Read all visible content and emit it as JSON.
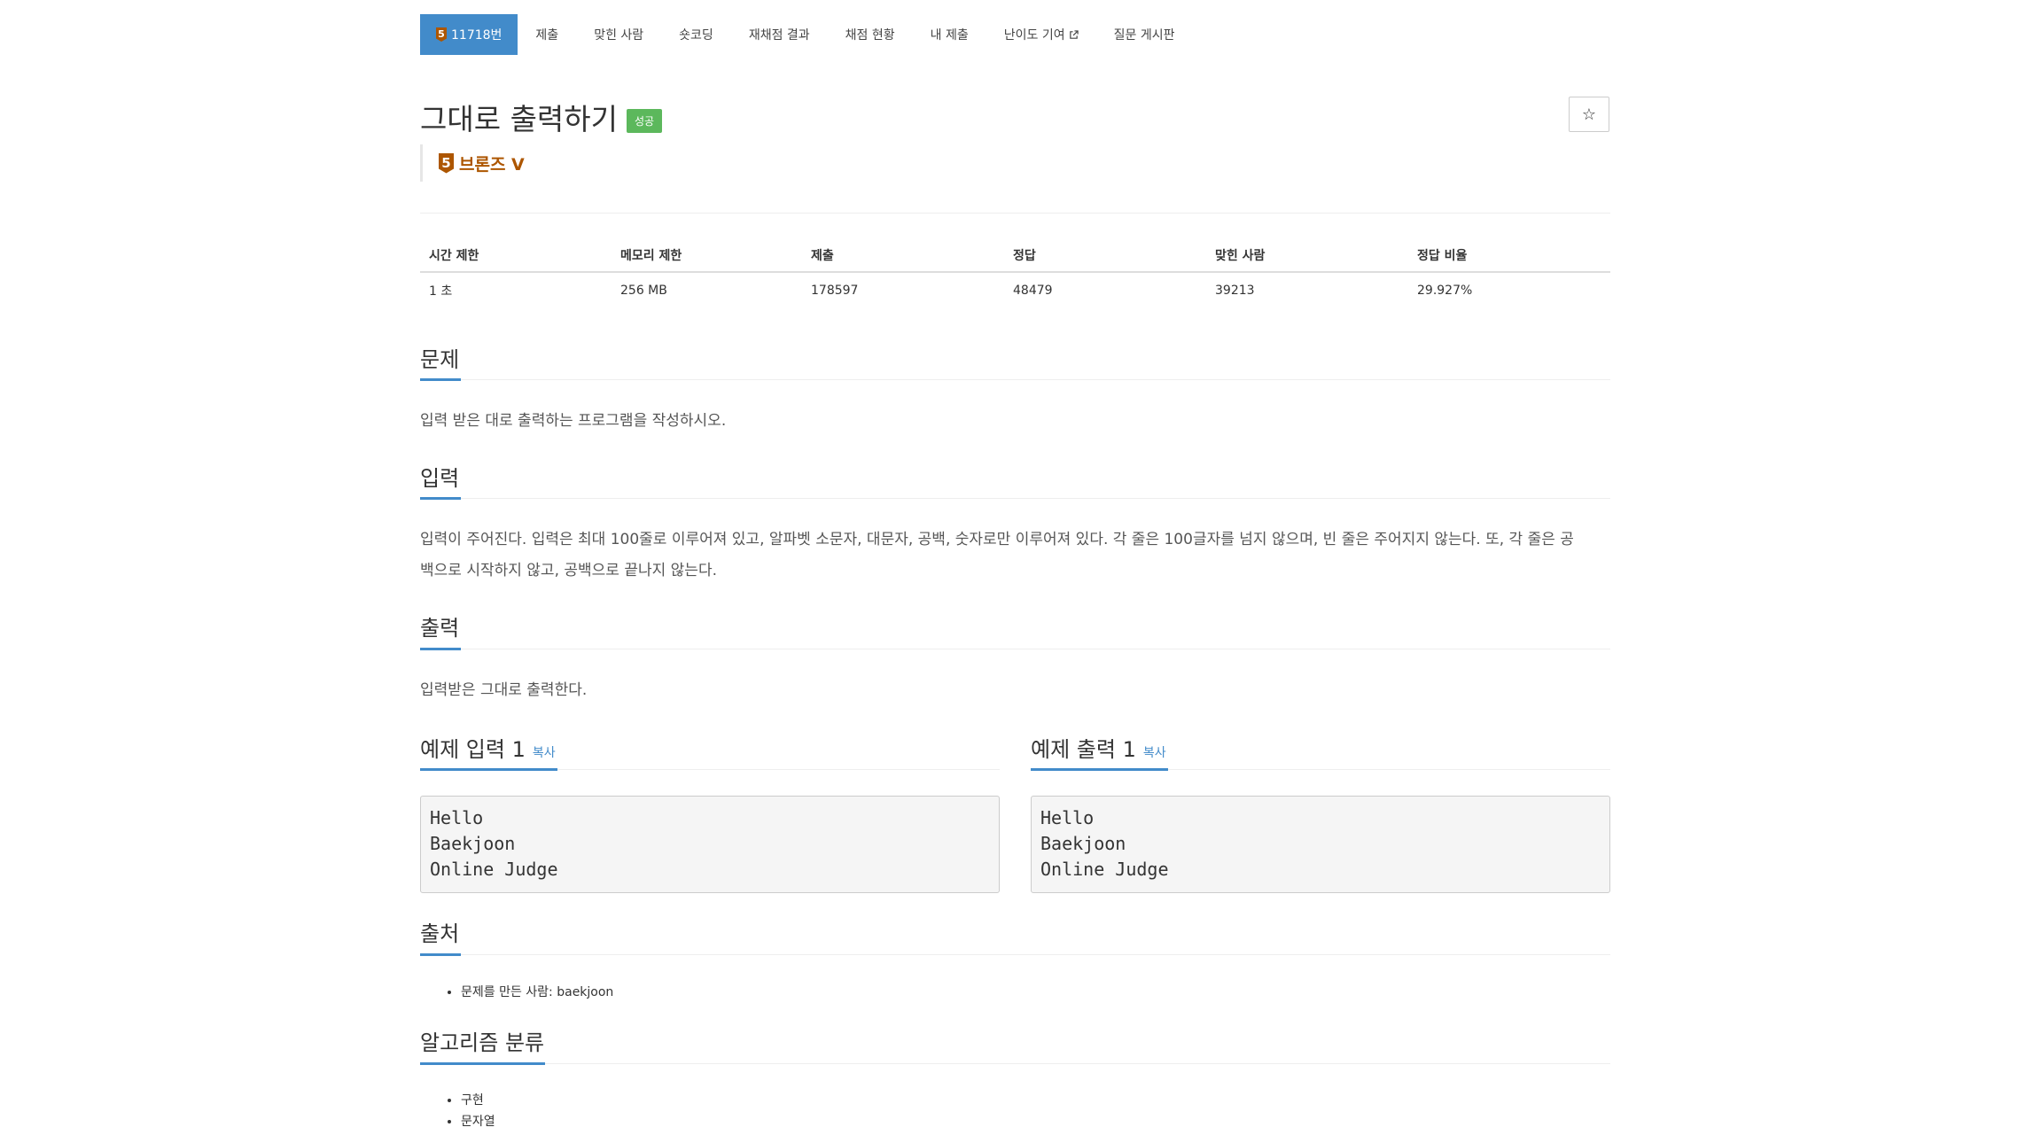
{
  "nav": {
    "problem_number": "11718번",
    "tier_digit": "5",
    "items": [
      "제출",
      "맞힌 사람",
      "숏코딩",
      "재채점 결과",
      "채점 현황",
      "내 제출",
      "난이도 기여",
      "질문 게시판"
    ]
  },
  "problem": {
    "title": "그대로 출력하기",
    "status_badge": "성공",
    "star_label": "☆",
    "tier_digit": "5",
    "tier_name": "브론즈 V"
  },
  "stats": {
    "headers": [
      "시간 제한",
      "메모리 제한",
      "제출",
      "정답",
      "맞힌 사람",
      "정답 비율"
    ],
    "values": [
      "1 초",
      "256 MB",
      "178597",
      "48479",
      "39213",
      "29.927%"
    ]
  },
  "sections": {
    "description_title": "문제",
    "description": "입력 받은 대로 출력하는 프로그램을 작성하시오.",
    "input_title": "입력",
    "input_line1": "입력이 주어진다. 입력은 최대 100줄로 이루어져 있고, 알파벳 소문자, 대문자, 공백, 숫자로만 이루어져 있다. 각 줄은 100글자를 넘지 않으며, 빈 줄은 주어지지 않는다. 또, 각 줄은 공",
    "input_line2": "백으로 시작하지 않고, 공백으로 끝나지 않는다.",
    "output_title": "출력",
    "output": "입력받은 그대로 출력한다.",
    "sample_input_title": "예제 입력 1",
    "sample_output_title": "예제 출력 1",
    "copy_label": "복사",
    "sample_input": "Hello\nBaekjoon\nOnline Judge",
    "sample_output": "Hello\nBaekjoon\nOnline Judge",
    "source_title": "출처",
    "source_items": [
      "문제를 만든 사람: baekjoon"
    ],
    "algo_title": "알고리즘 분류",
    "algo_items": [
      "구현",
      "문자열"
    ]
  },
  "colors": {
    "primary": "#428bca",
    "success": "#5cb85c",
    "bronze": "#ad5600"
  }
}
